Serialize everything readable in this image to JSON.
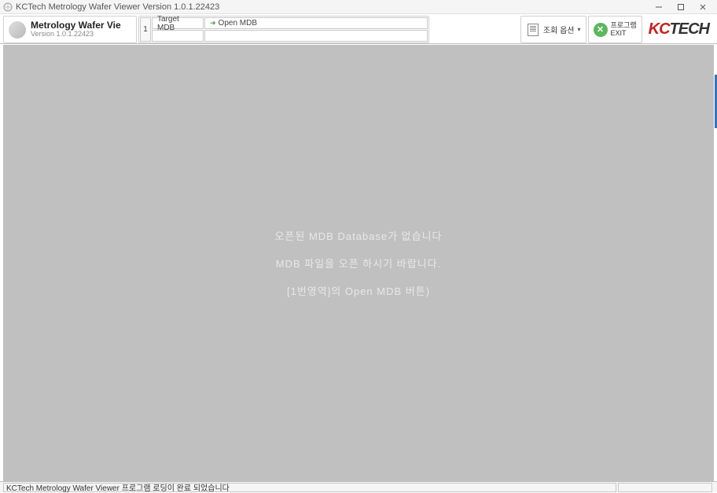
{
  "window": {
    "title": "KCTech Metrology Wafer Viewer Version 1.0.1.22423"
  },
  "app": {
    "title": "Metrology Wafer Vie",
    "version": "Version 1.0.1.22423"
  },
  "mdb": {
    "num": "1",
    "target_label": "Target MDB",
    "open_label": "Open MDB"
  },
  "toolbar": {
    "options_label": "조회 옵션",
    "exit_label1": "프로그램",
    "exit_label2": "EXIT"
  },
  "logo": {
    "part1": "KC",
    "part2": "TECH"
  },
  "content": {
    "line1": "오픈된 MDB Database가 없습니다",
    "line2": "MDB 파일을 오픈 하시기 바랍니다.",
    "line3": "[1번영역]의 Open MDB 버튼)"
  },
  "status": {
    "text": "KCTech Metrology Wafer Viewer 프로그램 로딩이 완료 되었습니다"
  }
}
